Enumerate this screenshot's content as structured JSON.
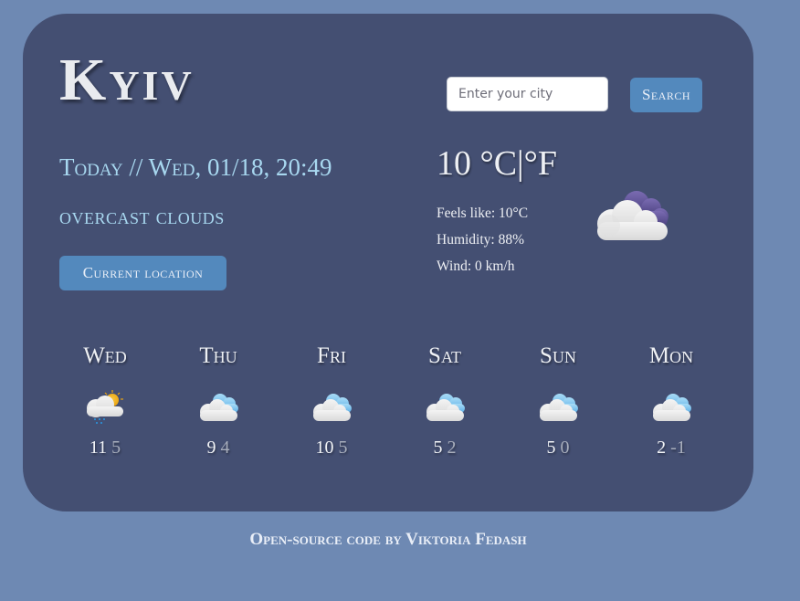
{
  "city": "Kyiv",
  "search": {
    "placeholder": "Enter your city",
    "value": "",
    "button_label": "Search"
  },
  "current": {
    "date_text": "Today // Wed, 01/18, 20:49",
    "description": "overcast clouds",
    "location_button_label": "Current location",
    "temperature": "10",
    "unit_celsius": "°C",
    "unit_separator": "|",
    "unit_fahrenheit": "°F",
    "feels_like": "Feels like: 10°C",
    "humidity": "Humidity: 88%",
    "wind": "Wind: 0 km/h",
    "icon": "overcast-clouds-icon"
  },
  "forecast": [
    {
      "day": "Wed",
      "max": "11",
      "min": "5",
      "icon": "sun-cloud-rain-icon"
    },
    {
      "day": "Thu",
      "max": "9",
      "min": "4",
      "icon": "cloud-icon"
    },
    {
      "day": "Fri",
      "max": "10",
      "min": "5",
      "icon": "cloud-icon"
    },
    {
      "day": "Sat",
      "max": "5",
      "min": "2",
      "icon": "cloud-icon"
    },
    {
      "day": "Sun",
      "max": "5",
      "min": "0",
      "icon": "cloud-icon"
    },
    {
      "day": "Mon",
      "max": "2",
      "min": "-1",
      "icon": "cloud-icon"
    }
  ],
  "footer": {
    "text": "Open-source code by Viktoria Fedash"
  },
  "colors": {
    "page_background": "#6e89b3",
    "card_background": "#444f72",
    "accent_button": "#5389bd",
    "highlight_text": "#a8d8f0"
  }
}
